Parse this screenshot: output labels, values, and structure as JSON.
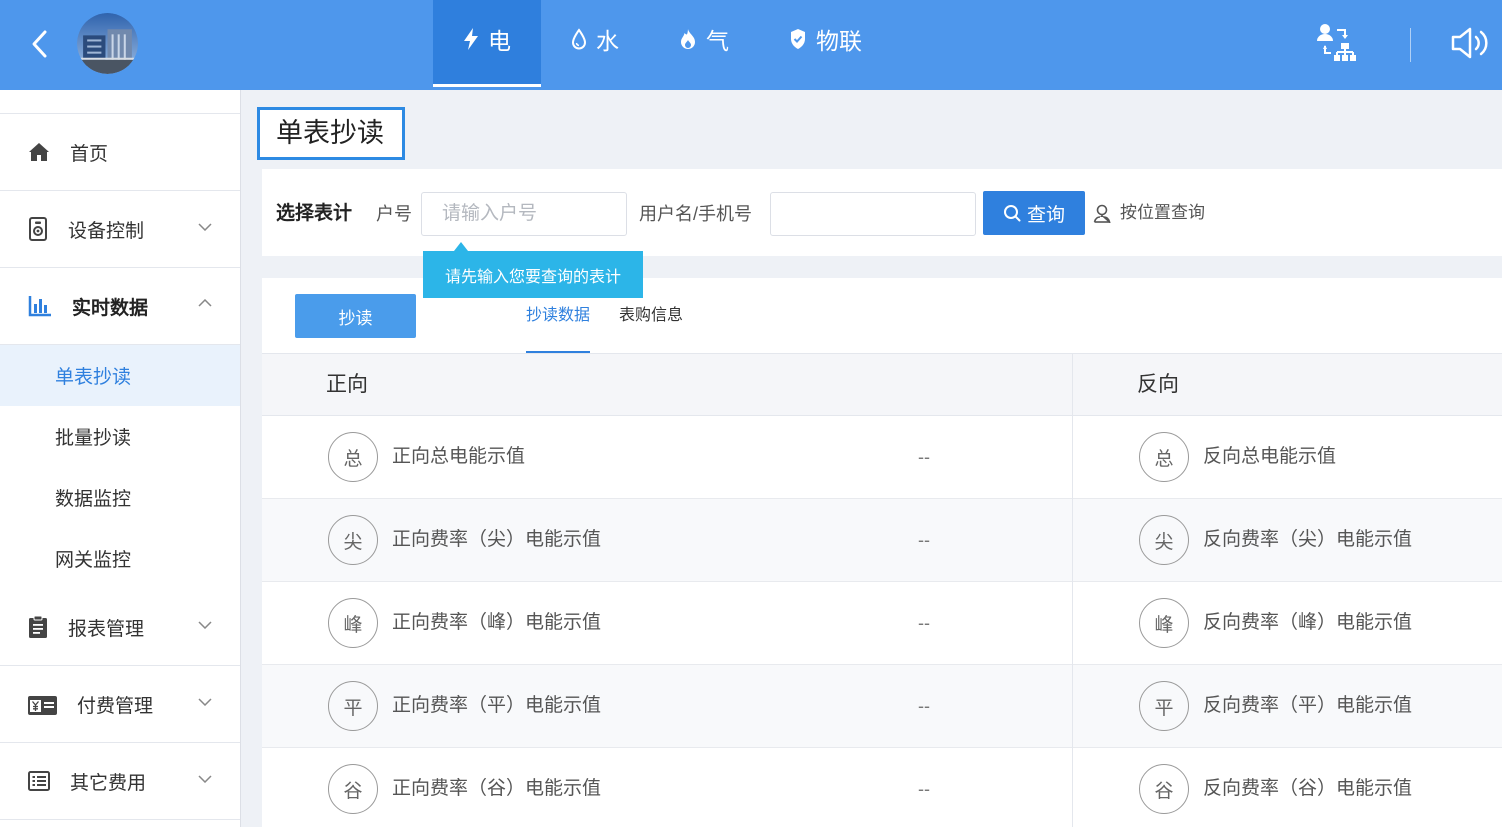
{
  "colors": {
    "header_bg": "#4e97ec",
    "header_active_tab": "#2f7fdd",
    "primary": "#2f80de",
    "tooltip_bg": "#2cb5e8",
    "sidebar_active_bg": "#e9f2fc",
    "page_bg": "#eef1f6"
  },
  "header": {
    "back_icon": "chevron-left-icon",
    "avatar_icon": "avatar-image",
    "tabs": [
      {
        "label": "电",
        "icon": "lightning-icon",
        "active": true
      },
      {
        "label": "水",
        "icon": "droplet-icon",
        "active": false
      },
      {
        "label": "气",
        "icon": "flame-icon",
        "active": false
      },
      {
        "label": "物联",
        "icon": "shield-icon",
        "active": false
      }
    ],
    "right_icons": [
      "org-switch-icon",
      "speaker-icon"
    ]
  },
  "sidebar": {
    "items": [
      {
        "label": "首页",
        "icon": "home-icon"
      },
      {
        "label": "设备控制",
        "icon": "device-icon",
        "expanded": false
      },
      {
        "label": "实时数据",
        "icon": "bar-chart-icon",
        "expanded": true,
        "children": [
          {
            "label": "单表抄读",
            "active": true
          },
          {
            "label": "批量抄读",
            "active": false
          },
          {
            "label": "数据监控",
            "active": false
          },
          {
            "label": "网关监控",
            "active": false
          }
        ]
      },
      {
        "label": "报表管理",
        "icon": "report-icon",
        "expanded": false
      },
      {
        "label": "付费管理",
        "icon": "payment-icon",
        "expanded": false
      },
      {
        "label": "其它费用",
        "icon": "list-icon",
        "expanded": false
      }
    ]
  },
  "page_title": "单表抄读",
  "search": {
    "section_label": "选择表计",
    "account_label": "户号",
    "account_value": "",
    "account_placeholder": "请输入户号",
    "user_label": "用户名/手机号",
    "user_value": "",
    "query_button": "查询",
    "location_query": "按位置查询"
  },
  "tooltip": "请先输入您要查询的表计",
  "panel": {
    "read_button": "抄读",
    "tabs": [
      {
        "label": "抄读数据",
        "active": true
      },
      {
        "label": "表购信息",
        "active": false
      }
    ]
  },
  "table": {
    "headers": {
      "forward": "正向",
      "reverse": "反向"
    },
    "rows": [
      {
        "forward": {
          "badge": "总",
          "label": "正向总电能示值",
          "value": "--"
        },
        "reverse": {
          "badge": "总",
          "label": "反向总电能示值"
        }
      },
      {
        "forward": {
          "badge": "尖",
          "label": "正向费率（尖）电能示值",
          "value": "--"
        },
        "reverse": {
          "badge": "尖",
          "label": "反向费率（尖）电能示值"
        }
      },
      {
        "forward": {
          "badge": "峰",
          "label": "正向费率（峰）电能示值",
          "value": "--"
        },
        "reverse": {
          "badge": "峰",
          "label": "反向费率（峰）电能示值"
        }
      },
      {
        "forward": {
          "badge": "平",
          "label": "正向费率（平）电能示值",
          "value": "--"
        },
        "reverse": {
          "badge": "平",
          "label": "反向费率（平）电能示值"
        }
      },
      {
        "forward": {
          "badge": "谷",
          "label": "正向费率（谷）电能示值",
          "value": "--"
        },
        "reverse": {
          "badge": "谷",
          "label": "反向费率（谷）电能示值"
        }
      }
    ]
  }
}
